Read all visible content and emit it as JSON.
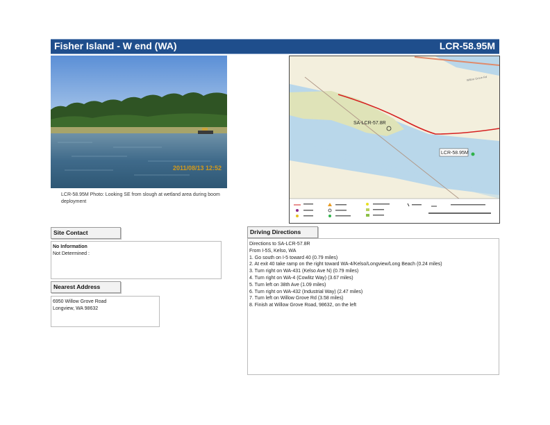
{
  "header": {
    "title": "Fisher Island - W end (WA)",
    "code": "LCR-58.95M",
    "background_color": "#1f4e8c"
  },
  "photo": {
    "caption": "LCR-58.95M Photo: Looking SE from slough at wetland area during boom deployment",
    "overlay_text": "2011/08/13 12:52"
  },
  "map": {
    "site_label": "SA-LCR-57.8R",
    "point_label": "LCR-58.95M",
    "road_label": "Willow Grove Rd"
  },
  "site_contact": {
    "label": "Site Contact",
    "name": "No Information",
    "detail": "Not Determined :"
  },
  "nearest_address": {
    "label": "Nearest Address",
    "line1": "6950 Willow Grove Road",
    "line2": "Longview, WA 98632"
  },
  "driving_directions": {
    "label": "Driving Directions",
    "lines": [
      "Directions to SA-LCR-57.8R",
      "From I-5S, Kelso, WA",
      "1. Go south on I-5 toward 40 (0.79 miles)",
      "2. At exit 40 take ramp on the right toward WA-4/Kelso/Longview/Long Beach (0.24 miles)",
      "3. Turn right on WA-431 (Kelso Ave N) (0.79 miles)",
      "4. Turn right on WA-4 (Cowlitz Way) (3.67 miles)",
      "5. Turn left on 38th Ave (1.09 miles)",
      "6. Turn right on WA-432 (Industrial Way) (2.47 miles)",
      "7. Turn left on Willow Grove Rd (3.58 miles)",
      "8. Finish at Willow Grove Road, 98632, on the left"
    ]
  }
}
